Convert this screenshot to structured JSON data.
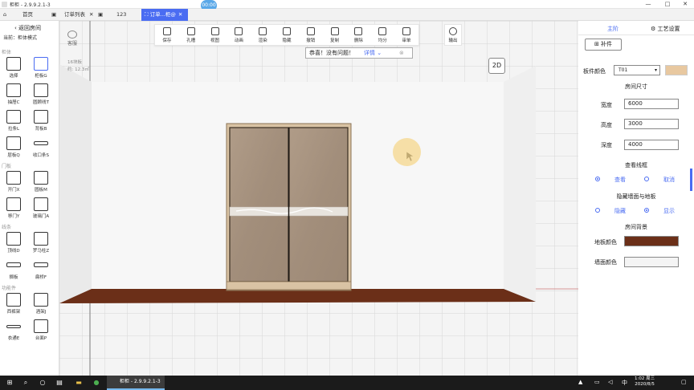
{
  "app": {
    "title": "柜柜 - 2.9.9.2.1-3"
  },
  "window_controls": {
    "minimize": "—",
    "maximize": "□",
    "close": "✕"
  },
  "timer": "00:00",
  "tabs": [
    {
      "label": "首页"
    },
    {
      "label": "订单列表"
    },
    {
      "label": "123"
    },
    {
      "label": "订单...柜@",
      "active": true
    }
  ],
  "left": {
    "back_label": "返回房间",
    "mode_label": "当前：柜体模式",
    "sections": [
      {
        "title": "柜体",
        "tools": [
          "选择",
          "柜板G",
          "抽屉C",
          "圆顾线T",
          "拉条L",
          "背板B",
          "层板Q",
          "收口条S"
        ]
      },
      {
        "title": "门板",
        "tools": [
          "开门X",
          "圆板M",
          "移门Y",
          "玻璃门A"
        ]
      },
      {
        "title": "线条",
        "tools": [
          "顶线D",
          "罗马柱Z",
          "搁板",
          "扁桥F"
        ]
      },
      {
        "title": "功能件",
        "tools": [
          "西裤架",
          "酒架J",
          "衣通E",
          "台面P"
        ]
      }
    ]
  },
  "toolbar": {
    "items": [
      "保存",
      "孔槽",
      "视图",
      "动画",
      "渲染",
      "隐藏",
      "撤销",
      "复制",
      "删除",
      "均分",
      "审单"
    ],
    "export": "输出"
  },
  "canvas": {
    "kefu": "客服",
    "info_line1": "16块板",
    "info_line2": "约: 12.3㎡",
    "notice": "恭喜！没有问题！",
    "notice_detail": "详情",
    "view_toggle": "2D"
  },
  "right": {
    "tab_main": "主阶",
    "tab_settings": "工艺设置",
    "patch_button": "补件",
    "board_color_label": "板件颜色",
    "board_color_value": "T01",
    "room_size_title": "房间尺寸",
    "width_label": "宽度",
    "width_value": "6000",
    "height_label": "高度",
    "height_value": "3000",
    "depth_label": "深度",
    "depth_value": "4000",
    "frame_title": "查看线框",
    "frame_view": "查看",
    "frame_cancel": "取消",
    "hide_title": "隐藏墙面与地板",
    "hide_opt": "隐藏",
    "show_opt": "显示",
    "bg_title": "房间背景",
    "floor_color_label": "地板颜色",
    "wall_color_label": "墙面颜色"
  },
  "colors": {
    "accent": "#4a6cf2",
    "floor": "#6b2f18",
    "wardrobe_door": "#a89482",
    "wardrobe_frame": "#d9c3a4"
  },
  "taskbar": {
    "active_app": "柜柜 - 2.9.9.2.1-3",
    "time": "1:02 周三",
    "date": "2020/8/5",
    "lang": "中"
  }
}
